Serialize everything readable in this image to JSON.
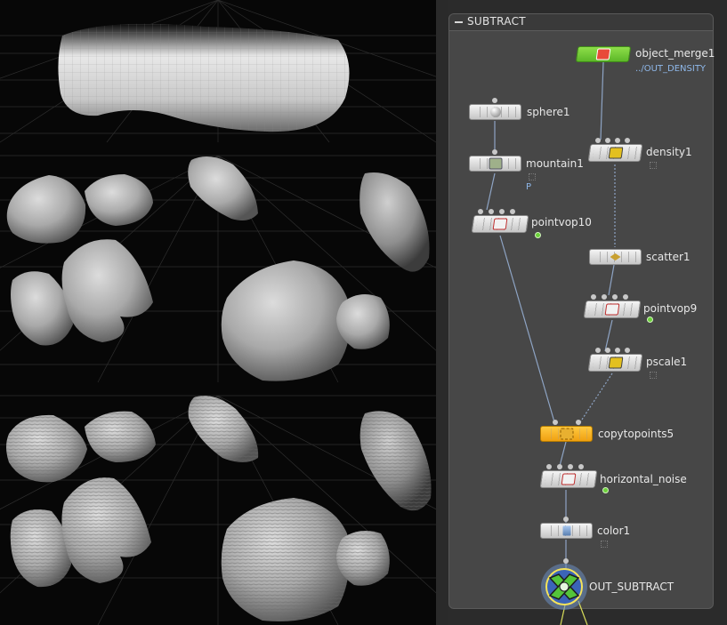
{
  "network": {
    "title": "SUBTRACT",
    "nodes": [
      {
        "id": "object_merge1",
        "label": "object_merge1",
        "sublabel": "../OUT_DENSITY",
        "color": "#78d233",
        "icon": "merge-icon"
      },
      {
        "id": "sphere1",
        "label": "sphere1",
        "icon": "sphere-icon"
      },
      {
        "id": "density1",
        "label": "density1",
        "icon": "density-icon"
      },
      {
        "id": "mountain1",
        "label": "mountain1",
        "sublabel": "P",
        "icon": "mountain-icon"
      },
      {
        "id": "pointvop10",
        "label": "pointvop10",
        "icon": "vop-icon"
      },
      {
        "id": "scatter1",
        "label": "scatter1",
        "icon": "scatter-icon"
      },
      {
        "id": "pointvop9",
        "label": "pointvop9",
        "icon": "vop-icon"
      },
      {
        "id": "pscale1",
        "label": "pscale1",
        "icon": "pscale-icon"
      },
      {
        "id": "copytopoints5",
        "label": "copytopoints5",
        "color": "#f5b220",
        "icon": "copy-icon"
      },
      {
        "id": "horizontal_noise",
        "label": "horizontal_noise",
        "icon": "vop-icon"
      },
      {
        "id": "color1",
        "label": "color1",
        "icon": "color-icon"
      },
      {
        "id": "OUT_SUBTRACT",
        "label": "OUT_SUBTRACT",
        "icon": "output-icon"
      }
    ]
  }
}
